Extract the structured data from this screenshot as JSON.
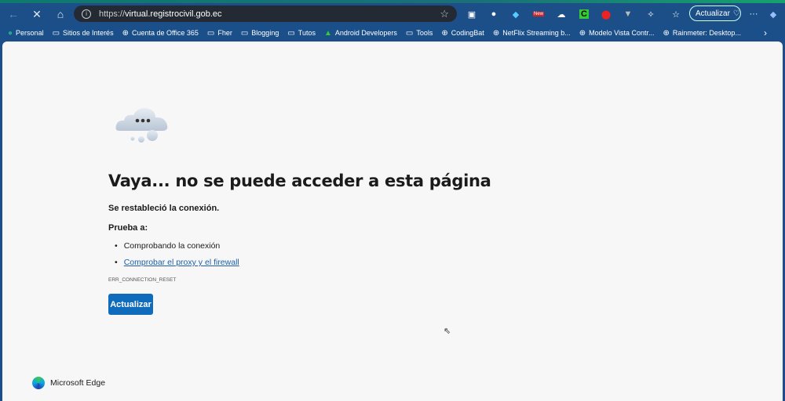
{
  "browser": {
    "url_prefix": "https://",
    "url_host": "virtual.registrocivil.gob.ec",
    "update_button": "Actualizar",
    "extensions": [
      "screen-icon",
      "ip-icon",
      "diamond-icon",
      "new-badge-icon",
      "cloud-icon",
      "c-icon",
      "shield-icon",
      "v-icon",
      "puzzle-icon"
    ],
    "new_badge": "New",
    "ext_c": "C"
  },
  "bookmarks": [
    "Personal",
    "Sitios de Interés",
    "Cuenta de Office 365",
    "Fher",
    "Blogging",
    "Tutos",
    "Android Developers",
    "Tools",
    "CodingBat",
    "NetFlix Streaming b...",
    "Modelo Vista Contr...",
    "Rainmeter: Desktop..."
  ],
  "error": {
    "title": "Vaya... no se puede acceder a esta página",
    "subtitle": "Se restableció la conexión.",
    "try_label": "Prueba a:",
    "suggestion1": "Comprobando la conexión",
    "suggestion2": "Comprobar el proxy y el firewall",
    "code": "ERR_CONNECTION_RESET",
    "button": "Actualizar"
  },
  "footer": {
    "brand": "Microsoft Edge"
  }
}
